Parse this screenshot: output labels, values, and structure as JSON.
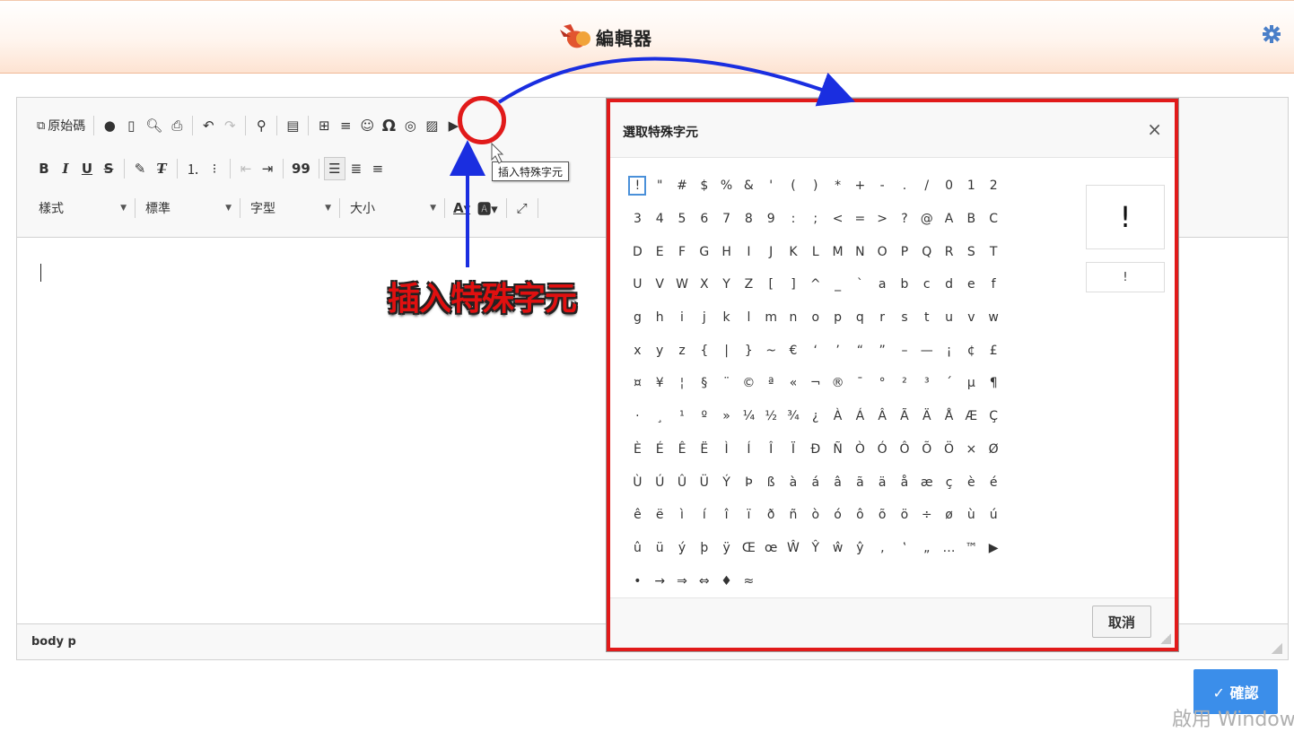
{
  "header": {
    "title": "編輯器",
    "logo_icon": "bird-logo-icon",
    "settings_icon": "gear-icon"
  },
  "toolbar": {
    "source_label": "原始碼",
    "style_combo": "樣式",
    "format_combo": "標準",
    "font_combo": "字型",
    "size_combo": "大小",
    "bold": "B",
    "italic": "I",
    "underline": "U",
    "strike": "S",
    "blockquote": "99",
    "special_char_symbol": "Ω",
    "tooltip": "插入特殊字元"
  },
  "editor": {
    "status_path": "body  p"
  },
  "dialog": {
    "title": "選取特殊字元",
    "close": "×",
    "rows": [
      [
        "!",
        "\"",
        "#",
        "$",
        "%",
        "&",
        "'",
        "(",
        ")",
        "*",
        "+",
        "-",
        ".",
        "/",
        "0",
        "1",
        "2"
      ],
      [
        "3",
        "4",
        "5",
        "6",
        "7",
        "8",
        "9",
        ":",
        ";",
        "<",
        "=",
        ">",
        "?",
        "@",
        "A",
        "B",
        "C"
      ],
      [
        "D",
        "E",
        "F",
        "G",
        "H",
        "I",
        "J",
        "K",
        "L",
        "M",
        "N",
        "O",
        "P",
        "Q",
        "R",
        "S",
        "T"
      ],
      [
        "U",
        "V",
        "W",
        "X",
        "Y",
        "Z",
        "[",
        "]",
        "^",
        "_",
        "`",
        "a",
        "b",
        "c",
        "d",
        "e",
        "f"
      ],
      [
        "g",
        "h",
        "i",
        "j",
        "k",
        "l",
        "m",
        "n",
        "o",
        "p",
        "q",
        "r",
        "s",
        "t",
        "u",
        "v",
        "w"
      ],
      [
        "x",
        "y",
        "z",
        "{",
        "|",
        "}",
        "~",
        "€",
        "‘",
        "’",
        "“",
        "”",
        "–",
        "—",
        "¡",
        "¢",
        "£"
      ],
      [
        "¤",
        "¥",
        "¦",
        "§",
        "¨",
        "©",
        "ª",
        "«",
        "¬",
        "®",
        "¯",
        "°",
        "²",
        "³",
        "´",
        "µ",
        "¶"
      ],
      [
        "·",
        "¸",
        "¹",
        "º",
        "»",
        "¼",
        "½",
        "¾",
        "¿",
        "À",
        "Á",
        "Â",
        "Ã",
        "Ä",
        "Å",
        "Æ",
        "Ç"
      ],
      [
        "È",
        "É",
        "Ê",
        "Ë",
        "Ì",
        "Í",
        "Î",
        "Ï",
        "Ð",
        "Ñ",
        "Ò",
        "Ó",
        "Ô",
        "Õ",
        "Ö",
        "×",
        "Ø"
      ],
      [
        "Ù",
        "Ú",
        "Û",
        "Ü",
        "Ý",
        "Þ",
        "ß",
        "à",
        "á",
        "â",
        "ã",
        "ä",
        "å",
        "æ",
        "ç",
        "è",
        "é"
      ],
      [
        "ê",
        "ë",
        "ì",
        "í",
        "î",
        "ï",
        "ð",
        "ñ",
        "ò",
        "ó",
        "ô",
        "õ",
        "ö",
        "÷",
        "ø",
        "ù",
        "ú"
      ],
      [
        "û",
        "ü",
        "ý",
        "þ",
        "ÿ",
        "Œ",
        "œ",
        "Ŵ",
        "Ŷ",
        "ŵ",
        "ŷ",
        "‚",
        "‛",
        "„",
        "…",
        "™",
        "▶"
      ],
      [
        "•",
        "→",
        "⇒",
        "⇔",
        "♦",
        "≈"
      ]
    ],
    "selected": "!",
    "preview_char": "!",
    "preview_code": "!",
    "cancel": "取消"
  },
  "annotation": {
    "label": "插入特殊字元",
    "color": "#e11a1a",
    "arrow_color": "#1a2ee0"
  },
  "confirm": {
    "label": "✓ 確認",
    "color": "#3b8eea"
  },
  "watermark": "啟用 Window"
}
